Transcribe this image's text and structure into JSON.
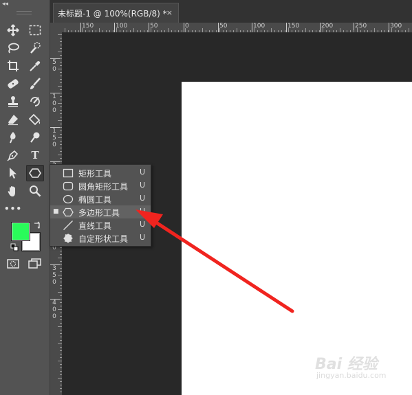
{
  "toolbar": {
    "collapse_label": "◂◂",
    "icons": [
      "move-tool-icon",
      "marquee-tool-icon",
      "lasso-tool-icon",
      "quick-selection-tool-icon",
      "crop-tool-icon",
      "eyedropper-tool-icon",
      "healing-brush-tool-icon",
      "brush-tool-icon",
      "clone-stamp-tool-icon",
      "history-brush-tool-icon",
      "eraser-tool-icon",
      "paint-bucket-tool-icon",
      "blur-tool-icon",
      "dodge-tool-icon",
      "pen-tool-icon",
      "type-tool-icon",
      "path-selection-tool-icon",
      "polygon-tool-icon",
      "hand-tool-icon",
      "zoom-tool-icon",
      "more-tools-icon",
      "quick-mask-icon",
      "screen-mode-icon"
    ],
    "foreground_color": "#2afb5a",
    "background_color": "#ffffff",
    "type_label": "T",
    "more_label": "•••"
  },
  "document": {
    "tab_title": "未标题-1 @ 100%(RGB/8) *",
    "close_label": "×",
    "canvas_color": "#ffffff"
  },
  "ruler": {
    "horizontal_labels": [
      "150",
      "100",
      "50",
      "0",
      "50",
      "100",
      "150",
      "200",
      "250",
      "300"
    ],
    "vertical_labels": [
      [
        "5",
        "0"
      ],
      [
        "1",
        "0",
        "0"
      ],
      [
        "1",
        "5",
        "0"
      ],
      [
        "2",
        "0",
        "0"
      ],
      [
        "2",
        "5",
        "0"
      ],
      [
        "3",
        "0",
        "0"
      ],
      [
        "3",
        "5",
        "0"
      ],
      [
        "4",
        "0",
        "0"
      ]
    ]
  },
  "flyout": {
    "items": [
      {
        "label": "矩形工具",
        "shortcut": "U",
        "icon": "rectangle-icon",
        "selected": false
      },
      {
        "label": "圆角矩形工具",
        "shortcut": "U",
        "icon": "rounded-rectangle-icon",
        "selected": false
      },
      {
        "label": "椭圆工具",
        "shortcut": "U",
        "icon": "ellipse-icon",
        "selected": false
      },
      {
        "label": "多边形工具",
        "shortcut": "U",
        "icon": "polygon-icon",
        "selected": true
      },
      {
        "label": "直线工具",
        "shortcut": "U",
        "icon": "line-icon",
        "selected": false
      },
      {
        "label": "自定形状工具",
        "shortcut": "U",
        "icon": "custom-shape-icon",
        "selected": false
      }
    ],
    "selected_marker": "■"
  },
  "annotation": {
    "arrow_color": "#f0241f"
  },
  "watermark": {
    "brand": "Bai 经验",
    "url": "jingyan.baidu.com"
  }
}
